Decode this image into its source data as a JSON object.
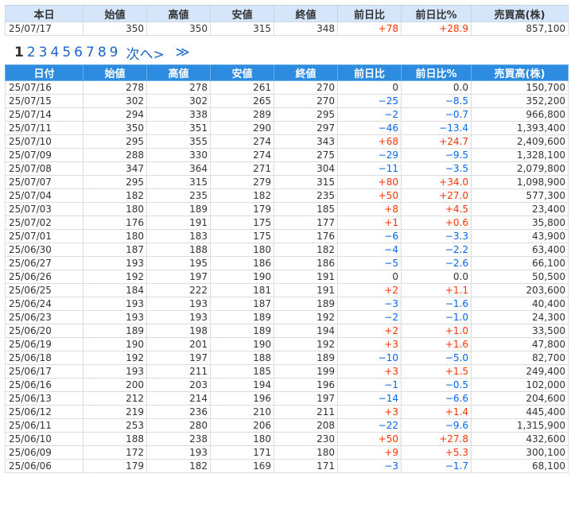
{
  "today": {
    "headers": [
      "本日",
      "始値",
      "高値",
      "安値",
      "終値",
      "前日比",
      "前日比%",
      "売買高(株)"
    ],
    "row": [
      "25/07/17",
      "350",
      "350",
      "315",
      "348",
      "+78",
      "+28.9",
      "857,100"
    ],
    "dir": "up"
  },
  "pager": {
    "pages": [
      "1",
      "2",
      "3",
      "4",
      "5",
      "6",
      "7",
      "8",
      "9"
    ],
    "current": "1",
    "next_label": "次へ>",
    "last_label": "≫"
  },
  "daily": {
    "headers": [
      "日付",
      "始値",
      "高値",
      "安値",
      "終値",
      "前日比",
      "前日比%",
      "売買高(株)"
    ],
    "rows": [
      [
        "25/07/16",
        "278",
        "278",
        "261",
        "270",
        "0",
        "0.0",
        "150,700"
      ],
      [
        "25/07/15",
        "302",
        "302",
        "265",
        "270",
        "−25",
        "−8.5",
        "352,200"
      ],
      [
        "25/07/14",
        "294",
        "338",
        "289",
        "295",
        "−2",
        "−0.7",
        "966,800"
      ],
      [
        "25/07/11",
        "350",
        "351",
        "290",
        "297",
        "−46",
        "−13.4",
        "1,393,400"
      ],
      [
        "25/07/10",
        "295",
        "355",
        "274",
        "343",
        "+68",
        "+24.7",
        "2,409,600"
      ],
      [
        "25/07/09",
        "288",
        "330",
        "274",
        "275",
        "−29",
        "−9.5",
        "1,328,100"
      ],
      [
        "25/07/08",
        "347",
        "364",
        "271",
        "304",
        "−11",
        "−3.5",
        "2,079,800"
      ],
      [
        "25/07/07",
        "295",
        "315",
        "279",
        "315",
        "+80",
        "+34.0",
        "1,098,900"
      ],
      [
        "25/07/04",
        "182",
        "235",
        "182",
        "235",
        "+50",
        "+27.0",
        "577,300"
      ],
      [
        "25/07/03",
        "180",
        "189",
        "179",
        "185",
        "+8",
        "+4.5",
        "23,400"
      ],
      [
        "25/07/02",
        "176",
        "191",
        "175",
        "177",
        "+1",
        "+0.6",
        "35,800"
      ],
      [
        "25/07/01",
        "180",
        "183",
        "175",
        "176",
        "−6",
        "−3.3",
        "43,900"
      ],
      [
        "25/06/30",
        "187",
        "188",
        "180",
        "182",
        "−4",
        "−2.2",
        "63,400"
      ],
      [
        "25/06/27",
        "193",
        "195",
        "186",
        "186",
        "−5",
        "−2.6",
        "66,100"
      ],
      [
        "25/06/26",
        "192",
        "197",
        "190",
        "191",
        "0",
        "0.0",
        "50,500"
      ],
      [
        "25/06/25",
        "184",
        "222",
        "181",
        "191",
        "+2",
        "+1.1",
        "203,600"
      ],
      [
        "25/06/24",
        "193",
        "193",
        "187",
        "189",
        "−3",
        "−1.6",
        "40,400"
      ],
      [
        "25/06/23",
        "193",
        "193",
        "189",
        "192",
        "−2",
        "−1.0",
        "24,300"
      ],
      [
        "25/06/20",
        "189",
        "198",
        "189",
        "194",
        "+2",
        "+1.0",
        "33,500"
      ],
      [
        "25/06/19",
        "190",
        "201",
        "190",
        "192",
        "+3",
        "+1.6",
        "47,800"
      ],
      [
        "25/06/18",
        "192",
        "197",
        "188",
        "189",
        "−10",
        "−5.0",
        "82,700"
      ],
      [
        "25/06/17",
        "193",
        "211",
        "185",
        "199",
        "+3",
        "+1.5",
        "249,400"
      ],
      [
        "25/06/16",
        "200",
        "203",
        "194",
        "196",
        "−1",
        "−0.5",
        "102,000"
      ],
      [
        "25/06/13",
        "212",
        "214",
        "196",
        "197",
        "−14",
        "−6.6",
        "204,600"
      ],
      [
        "25/06/12",
        "219",
        "236",
        "210",
        "211",
        "+3",
        "+1.4",
        "445,400"
      ],
      [
        "25/06/11",
        "253",
        "280",
        "206",
        "208",
        "−22",
        "−9.6",
        "1,315,900"
      ],
      [
        "25/06/10",
        "188",
        "238",
        "180",
        "230",
        "+50",
        "+27.8",
        "432,600"
      ],
      [
        "25/06/09",
        "172",
        "193",
        "171",
        "180",
        "+9",
        "+5.3",
        "300,100"
      ],
      [
        "25/06/06",
        "179",
        "182",
        "169",
        "171",
        "−3",
        "−1.7",
        "68,100"
      ]
    ]
  },
  "colors": {
    "up": "#ff3300",
    "down": "#0066ee",
    "header_blue": "#2d8be0",
    "header_light": "#d5e6fb",
    "link": "#1a66c4"
  }
}
